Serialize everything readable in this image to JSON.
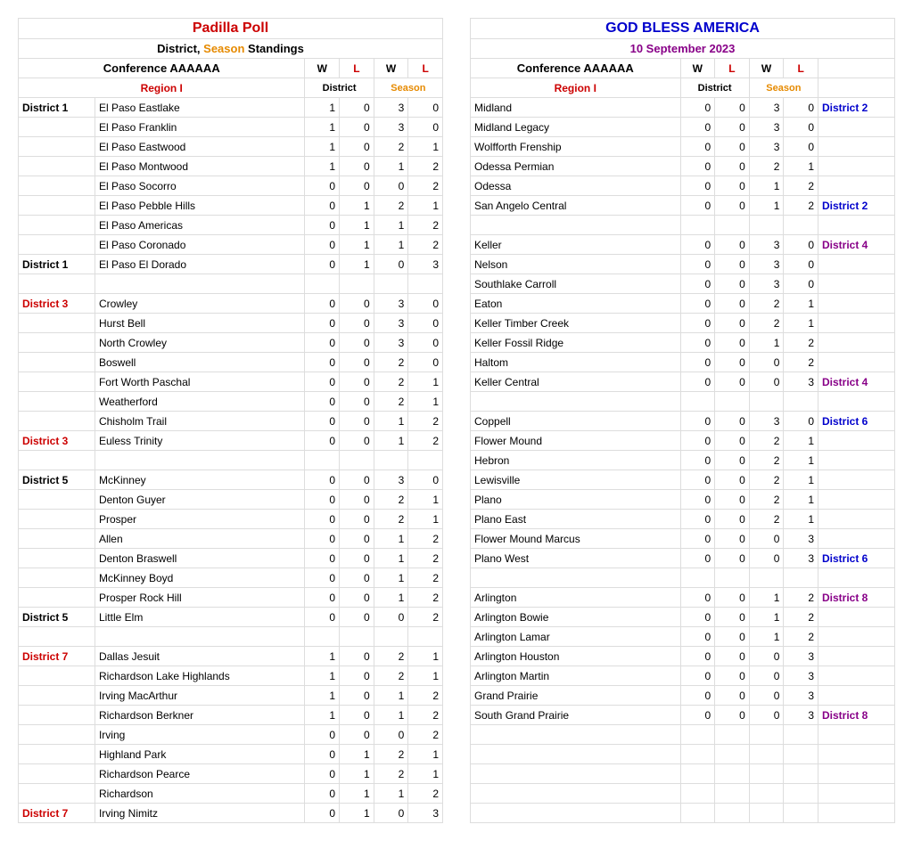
{
  "header": {
    "title_left": "Padilla Poll",
    "title_right": "GOD BLESS AMERICA",
    "subtitle_left_pre": "District, ",
    "subtitle_left_season": "Season",
    "subtitle_left_post": " Standings",
    "date": "10 September 2023",
    "conference": "Conference AAAAAA",
    "W": "W",
    "L": "L",
    "region": "Region I",
    "district_hdr": "District",
    "season_hdr": "Season"
  },
  "left_rows": [
    {
      "d": "District 1",
      "dc": "dist-label",
      "t": "El Paso Eastlake",
      "dw": "1",
      "dl": "0",
      "sw": "3",
      "sl": "0"
    },
    {
      "d": "",
      "dc": "",
      "t": "El Paso Franklin",
      "dw": "1",
      "dl": "0",
      "sw": "3",
      "sl": "0"
    },
    {
      "d": "",
      "dc": "",
      "t": "El Paso Eastwood",
      "dw": "1",
      "dl": "0",
      "sw": "2",
      "sl": "1"
    },
    {
      "d": "",
      "dc": "",
      "t": "El Paso Montwood",
      "dw": "1",
      "dl": "0",
      "sw": "1",
      "sl": "2"
    },
    {
      "d": "",
      "dc": "",
      "t": "El Paso Socorro",
      "dw": "0",
      "dl": "0",
      "sw": "0",
      "sl": "2"
    },
    {
      "d": "",
      "dc": "",
      "t": "El Paso Pebble Hills",
      "dw": "0",
      "dl": "1",
      "sw": "2",
      "sl": "1"
    },
    {
      "d": "",
      "dc": "",
      "t": "El Paso Americas",
      "dw": "0",
      "dl": "1",
      "sw": "1",
      "sl": "2"
    },
    {
      "d": "",
      "dc": "",
      "t": "El Paso Coronado",
      "dw": "0",
      "dl": "1",
      "sw": "1",
      "sl": "2"
    },
    {
      "d": "District 1",
      "dc": "dist-label",
      "t": "El Paso El Dorado",
      "dw": "0",
      "dl": "1",
      "sw": "0",
      "sl": "3"
    },
    {
      "d": "",
      "dc": "",
      "t": "",
      "dw": "",
      "dl": "",
      "sw": "",
      "sl": ""
    },
    {
      "d": "District 3",
      "dc": "dist-red",
      "t": "Crowley",
      "dw": "0",
      "dl": "0",
      "sw": "3",
      "sl": "0"
    },
    {
      "d": "",
      "dc": "",
      "t": "Hurst Bell",
      "dw": "0",
      "dl": "0",
      "sw": "3",
      "sl": "0"
    },
    {
      "d": "",
      "dc": "",
      "t": "North Crowley",
      "dw": "0",
      "dl": "0",
      "sw": "3",
      "sl": "0"
    },
    {
      "d": "",
      "dc": "",
      "t": "Boswell",
      "dw": "0",
      "dl": "0",
      "sw": "2",
      "sl": "0"
    },
    {
      "d": "",
      "dc": "",
      "t": "Fort Worth Paschal",
      "dw": "0",
      "dl": "0",
      "sw": "2",
      "sl": "1"
    },
    {
      "d": "",
      "dc": "",
      "t": "Weatherford",
      "dw": "0",
      "dl": "0",
      "sw": "2",
      "sl": "1"
    },
    {
      "d": "",
      "dc": "",
      "t": "Chisholm Trail",
      "dw": "0",
      "dl": "0",
      "sw": "1",
      "sl": "2"
    },
    {
      "d": "District 3",
      "dc": "dist-red",
      "t": "Euless Trinity",
      "dw": "0",
      "dl": "0",
      "sw": "1",
      "sl": "2"
    },
    {
      "d": "",
      "dc": "",
      "t": "",
      "dw": "",
      "dl": "",
      "sw": "",
      "sl": ""
    },
    {
      "d": "District 5",
      "dc": "dist-label",
      "t": "McKinney",
      "dw": "0",
      "dl": "0",
      "sw": "3",
      "sl": "0"
    },
    {
      "d": "",
      "dc": "",
      "t": "Denton Guyer",
      "dw": "0",
      "dl": "0",
      "sw": "2",
      "sl": "1"
    },
    {
      "d": "",
      "dc": "",
      "t": "Prosper",
      "dw": "0",
      "dl": "0",
      "sw": "2",
      "sl": "1"
    },
    {
      "d": "",
      "dc": "",
      "t": "Allen",
      "dw": "0",
      "dl": "0",
      "sw": "1",
      "sl": "2"
    },
    {
      "d": "",
      "dc": "",
      "t": "Denton Braswell",
      "dw": "0",
      "dl": "0",
      "sw": "1",
      "sl": "2"
    },
    {
      "d": "",
      "dc": "",
      "t": "McKinney Boyd",
      "dw": "0",
      "dl": "0",
      "sw": "1",
      "sl": "2"
    },
    {
      "d": "",
      "dc": "",
      "t": "Prosper Rock Hill",
      "dw": "0",
      "dl": "0",
      "sw": "1",
      "sl": "2"
    },
    {
      "d": "District 5",
      "dc": "dist-label",
      "t": "Little Elm",
      "dw": "0",
      "dl": "0",
      "sw": "0",
      "sl": "2"
    },
    {
      "d": "",
      "dc": "",
      "t": "",
      "dw": "",
      "dl": "",
      "sw": "",
      "sl": ""
    },
    {
      "d": "District 7",
      "dc": "dist-red",
      "t": "Dallas Jesuit",
      "dw": "1",
      "dl": "0",
      "sw": "2",
      "sl": "1"
    },
    {
      "d": "",
      "dc": "",
      "t": "Richardson Lake Highlands",
      "dw": "1",
      "dl": "0",
      "sw": "2",
      "sl": "1"
    },
    {
      "d": "",
      "dc": "",
      "t": "Irving MacArthur",
      "dw": "1",
      "dl": "0",
      "sw": "1",
      "sl": "2"
    },
    {
      "d": "",
      "dc": "",
      "t": "Richardson Berkner",
      "dw": "1",
      "dl": "0",
      "sw": "1",
      "sl": "2"
    },
    {
      "d": "",
      "dc": "",
      "t": "Irving",
      "dw": "0",
      "dl": "0",
      "sw": "0",
      "sl": "2"
    },
    {
      "d": "",
      "dc": "",
      "t": "Highland Park",
      "dw": "0",
      "dl": "1",
      "sw": "2",
      "sl": "1"
    },
    {
      "d": "",
      "dc": "",
      "t": "Richardson Pearce",
      "dw": "0",
      "dl": "1",
      "sw": "2",
      "sl": "1"
    },
    {
      "d": "",
      "dc": "",
      "t": "Richardson",
      "dw": "0",
      "dl": "1",
      "sw": "1",
      "sl": "2"
    },
    {
      "d": "District 7",
      "dc": "dist-red",
      "t": "Irving Nimitz",
      "dw": "0",
      "dl": "1",
      "sw": "0",
      "sl": "3"
    }
  ],
  "right_rows": [
    {
      "t": "Midland",
      "dw": "0",
      "dl": "0",
      "sw": "3",
      "sl": "0",
      "d": "District 2",
      "dc": "dist-blue"
    },
    {
      "t": "Midland Legacy",
      "dw": "0",
      "dl": "0",
      "sw": "3",
      "sl": "0",
      "d": "",
      "dc": ""
    },
    {
      "t": "Wolfforth Frenship",
      "dw": "0",
      "dl": "0",
      "sw": "3",
      "sl": "0",
      "d": "",
      "dc": ""
    },
    {
      "t": "Odessa Permian",
      "dw": "0",
      "dl": "0",
      "sw": "2",
      "sl": "1",
      "d": "",
      "dc": ""
    },
    {
      "t": "Odessa",
      "dw": "0",
      "dl": "0",
      "sw": "1",
      "sl": "2",
      "d": "",
      "dc": ""
    },
    {
      "t": "San Angelo Central",
      "dw": "0",
      "dl": "0",
      "sw": "1",
      "sl": "2",
      "d": "District 2",
      "dc": "dist-blue"
    },
    {
      "t": "",
      "dw": "",
      "dl": "",
      "sw": "",
      "sl": "",
      "d": "",
      "dc": ""
    },
    {
      "t": "Keller",
      "dw": "0",
      "dl": "0",
      "sw": "3",
      "sl": "0",
      "d": "District 4",
      "dc": "dist-purple"
    },
    {
      "t": "Nelson",
      "dw": "0",
      "dl": "0",
      "sw": "3",
      "sl": "0",
      "d": "",
      "dc": ""
    },
    {
      "t": "Southlake Carroll",
      "dw": "0",
      "dl": "0",
      "sw": "3",
      "sl": "0",
      "d": "",
      "dc": ""
    },
    {
      "t": "Eaton",
      "dw": "0",
      "dl": "0",
      "sw": "2",
      "sl": "1",
      "d": "",
      "dc": ""
    },
    {
      "t": "Keller Timber Creek",
      "dw": "0",
      "dl": "0",
      "sw": "2",
      "sl": "1",
      "d": "",
      "dc": ""
    },
    {
      "t": "Keller Fossil Ridge",
      "dw": "0",
      "dl": "0",
      "sw": "1",
      "sl": "2",
      "d": "",
      "dc": ""
    },
    {
      "t": "Haltom",
      "dw": "0",
      "dl": "0",
      "sw": "0",
      "sl": "2",
      "d": "",
      "dc": ""
    },
    {
      "t": "Keller Central",
      "dw": "0",
      "dl": "0",
      "sw": "0",
      "sl": "3",
      "d": "District 4",
      "dc": "dist-purple"
    },
    {
      "t": "",
      "dw": "",
      "dl": "",
      "sw": "",
      "sl": "",
      "d": "",
      "dc": ""
    },
    {
      "t": "Coppell",
      "dw": "0",
      "dl": "0",
      "sw": "3",
      "sl": "0",
      "d": "District 6",
      "dc": "dist-blue"
    },
    {
      "t": "Flower Mound",
      "dw": "0",
      "dl": "0",
      "sw": "2",
      "sl": "1",
      "d": "",
      "dc": ""
    },
    {
      "t": "Hebron",
      "dw": "0",
      "dl": "0",
      "sw": "2",
      "sl": "1",
      "d": "",
      "dc": ""
    },
    {
      "t": "Lewisville",
      "dw": "0",
      "dl": "0",
      "sw": "2",
      "sl": "1",
      "d": "",
      "dc": ""
    },
    {
      "t": "Plano",
      "dw": "0",
      "dl": "0",
      "sw": "2",
      "sl": "1",
      "d": "",
      "dc": ""
    },
    {
      "t": "Plano East",
      "dw": "0",
      "dl": "0",
      "sw": "2",
      "sl": "1",
      "d": "",
      "dc": ""
    },
    {
      "t": "Flower Mound Marcus",
      "dw": "0",
      "dl": "0",
      "sw": "0",
      "sl": "3",
      "d": "",
      "dc": ""
    },
    {
      "t": "Plano West",
      "dw": "0",
      "dl": "0",
      "sw": "0",
      "sl": "3",
      "d": "District 6",
      "dc": "dist-blue"
    },
    {
      "t": "",
      "dw": "",
      "dl": "",
      "sw": "",
      "sl": "",
      "d": "",
      "dc": ""
    },
    {
      "t": "Arlington",
      "dw": "0",
      "dl": "0",
      "sw": "1",
      "sl": "2",
      "d": "District 8",
      "dc": "dist-purple"
    },
    {
      "t": "Arlington Bowie",
      "dw": "0",
      "dl": "0",
      "sw": "1",
      "sl": "2",
      "d": "",
      "dc": ""
    },
    {
      "t": "Arlington Lamar",
      "dw": "0",
      "dl": "0",
      "sw": "1",
      "sl": "2",
      "d": "",
      "dc": ""
    },
    {
      "t": "Arlington Houston",
      "dw": "0",
      "dl": "0",
      "sw": "0",
      "sl": "3",
      "d": "",
      "dc": ""
    },
    {
      "t": "Arlington Martin",
      "dw": "0",
      "dl": "0",
      "sw": "0",
      "sl": "3",
      "d": "",
      "dc": ""
    },
    {
      "t": "Grand Prairie",
      "dw": "0",
      "dl": "0",
      "sw": "0",
      "sl": "3",
      "d": "",
      "dc": ""
    },
    {
      "t": "South Grand Prairie",
      "dw": "0",
      "dl": "0",
      "sw": "0",
      "sl": "3",
      "d": "District 8",
      "dc": "dist-purple"
    },
    {
      "t": "",
      "dw": "",
      "dl": "",
      "sw": "",
      "sl": "",
      "d": "",
      "dc": ""
    },
    {
      "t": "",
      "dw": "",
      "dl": "",
      "sw": "",
      "sl": "",
      "d": "",
      "dc": ""
    },
    {
      "t": "",
      "dw": "",
      "dl": "",
      "sw": "",
      "sl": "",
      "d": "",
      "dc": ""
    },
    {
      "t": "",
      "dw": "",
      "dl": "",
      "sw": "",
      "sl": "",
      "d": "",
      "dc": ""
    },
    {
      "t": "",
      "dw": "",
      "dl": "",
      "sw": "",
      "sl": "",
      "d": "",
      "dc": ""
    }
  ]
}
